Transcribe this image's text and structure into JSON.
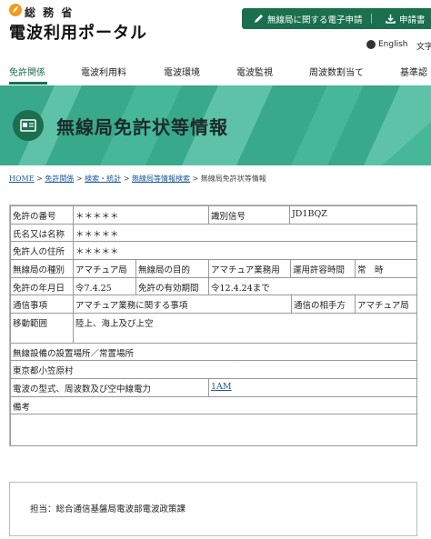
{
  "header": {
    "ministry": "総 務 省",
    "portal_name": "電波利用ポータル",
    "e_application": "無線局に関する電子申請",
    "application_docs": "申請書",
    "language": "English",
    "font_size": "文字"
  },
  "nav": {
    "items": [
      "免許関係",
      "電波利用料",
      "電波環境",
      "電波監視",
      "周波数割当て",
      "基準認"
    ]
  },
  "banner": {
    "title": "無線局免許状等情報"
  },
  "breadcrumb": {
    "links": [
      "HOME",
      "免許関係",
      "検索・統計",
      "無線局等情報検索"
    ],
    "current": "無線局免許状等情報",
    "separator": ">"
  },
  "license": {
    "license_number_label": "免許の番号",
    "license_number_value": "＊＊＊＊＊",
    "callsign_label": "識別信号",
    "callsign_value": "JD1BQZ",
    "name_label": "氏名又は名称",
    "name_value": "＊＊＊＊＊",
    "address_label": "免許人の住所",
    "address_value": "＊＊＊＊＊",
    "station_type_label": "無線局の種別",
    "station_type_value": "アマチュア局",
    "purpose_label": "無線局の目的",
    "purpose_value": "アマチュア業務用",
    "operation_hours_label": "運用許容時間",
    "operation_hours_value": "常　時",
    "license_date_label": "免許の年月日",
    "license_date_value": "令7.4.25",
    "validity_label": "免許の有効期間",
    "validity_value": "令12.4.24まで",
    "comm_matters_label": "通信事項",
    "comm_matters_value": "アマチュア業務に関する事項",
    "comm_partner_label": "通信の相手方",
    "comm_partner_value": "アマチュア局",
    "mobile_range_label": "移動範囲",
    "mobile_range_value": "陸上、海上及び上空",
    "location_label": "無線設備の設置場所／常置場所",
    "location_value": "東京都小笠原村",
    "emission_label": "電波の型式、周波数及び空中線電力",
    "emission_value": "1AM",
    "remarks_label": "備考"
  },
  "footer": {
    "contact": "担当：総合通信基盤局電波部電波政策課"
  },
  "colors": {
    "brand_green": "#1a6f4f",
    "banner_green": "#47b79a",
    "logo_orange": "#f29a1c"
  }
}
